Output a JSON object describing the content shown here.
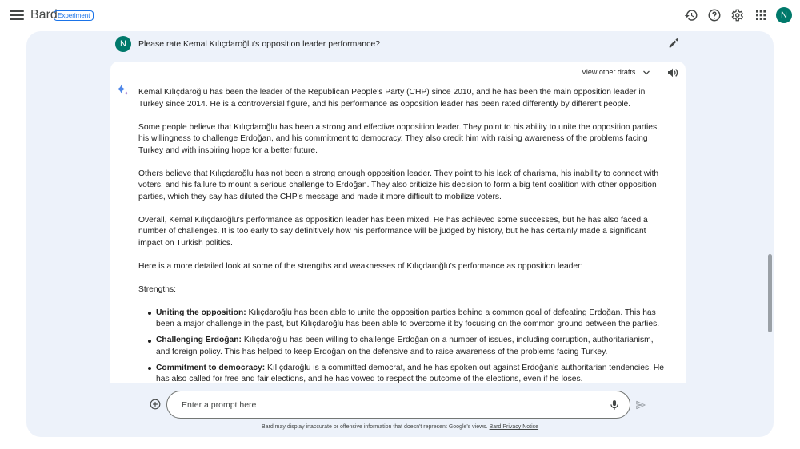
{
  "app": {
    "name": "Bard",
    "badge": "Experiment"
  },
  "top_icons": [
    "history-icon",
    "help-icon",
    "settings-icon",
    "apps-grid-icon"
  ],
  "user": {
    "initial": "N"
  },
  "prompt": {
    "text": "Please rate Kemal Kılıçdaroğlu's opposition leader performance?"
  },
  "response": {
    "drafts_label": "View other drafts",
    "paragraphs": [
      "Kemal Kılıçdaroğlu has been the leader of the Republican People's Party (CHP) since 2010, and he has been the main opposition leader in Turkey since 2014. He is a controversial figure, and his performance as opposition leader has been rated differently by different people.",
      "Some people believe that Kılıçdaroğlu has been a strong and effective opposition leader. They point to his ability to unite the opposition parties, his willingness to challenge Erdoğan, and his commitment to democracy. They also credit him with raising awareness of the problems facing Turkey and with inspiring hope for a better future.",
      "Others believe that Kılıçdaroğlu has not been a strong enough opposition leader. They point to his lack of charisma, his inability to connect with voters, and his failure to mount a serious challenge to Erdoğan. They also criticize his decision to form a big tent coalition with other opposition parties, which they say has diluted the CHP's message and made it more difficult to mobilize voters.",
      "Overall, Kemal Kılıçdaroğlu's performance as opposition leader has been mixed. He has achieved some successes, but he has also faced a number of challenges. It is too early to say definitively how his performance will be judged by history, but he has certainly made a significant impact on Turkish politics.",
      "Here is a more detailed look at some of the strengths and weaknesses of Kılıçdaroğlu's performance as opposition leader:"
    ],
    "strengths_heading": "Strengths:",
    "strengths": [
      {
        "title": "Uniting the opposition:",
        "text": " Kılıçdaroğlu has been able to unite the opposition parties behind a common goal of defeating Erdoğan. This has been a major challenge in the past, but Kılıçdaroğlu has been able to overcome it by focusing on the common ground between the parties."
      },
      {
        "title": "Challenging Erdoğan:",
        "text": " Kılıçdaroğlu has been willing to challenge Erdoğan on a number of issues, including corruption, authoritarianism, and foreign policy. This has helped to keep Erdoğan on the defensive and to raise awareness of the problems facing Turkey."
      },
      {
        "title": "Commitment to democracy:",
        "text": " Kılıçdaroğlu is a committed democrat, and he has spoken out against Erdoğan's authoritarian tendencies. He has also called for free and fair elections, and he has vowed to respect the outcome of the elections, even if he loses."
      }
    ]
  },
  "input": {
    "placeholder": "Enter a prompt here"
  },
  "footer": {
    "note": "Bard may display inaccurate or offensive information that doesn't represent Google's views.",
    "link": "Bard Privacy Notice"
  }
}
